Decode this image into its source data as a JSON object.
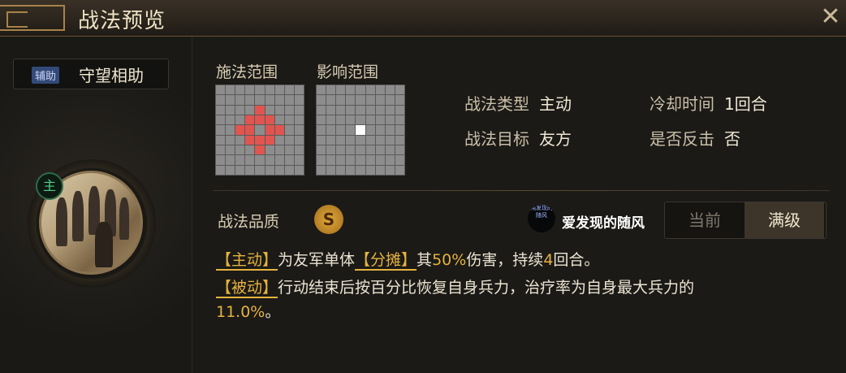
{
  "header": {
    "title": "战法预览",
    "close_icon": "close-icon"
  },
  "skill": {
    "type_badge": "辅助",
    "name": "守望相助",
    "commander_badge": "主"
  },
  "ranges": {
    "cast_label": "施法范围",
    "effect_label": "影响范围"
  },
  "info": {
    "type_label": "战法类型",
    "type_value": "主动",
    "cooldown_label": "冷却时间",
    "cooldown_value": "1回合",
    "target_label": "战法目标",
    "target_value": "友方",
    "counter_label": "是否反击",
    "counter_value": "否"
  },
  "quality": {
    "label": "战法品质",
    "grade": "S"
  },
  "watermark": {
    "icon_text": "纯发现的随风",
    "text": "爱发现的随风"
  },
  "level_toggle": {
    "current": "当前",
    "max": "满级"
  },
  "description": {
    "line1": {
      "tag1": "【主动】",
      "t1": "为友军单体",
      "tag2": "【分摊】",
      "t2": "其",
      "pct": "50%",
      "t3": "伤害，持续",
      "turns": "4",
      "t4": "回合。"
    },
    "line2": {
      "tag": "【被动】",
      "text": "行动结束后按百分比恢复自身兵力，治疗率为自身最大兵力的"
    },
    "line3": {
      "value": "11.0%",
      "end": "。"
    }
  },
  "colors": {
    "accent": "#e5b23e",
    "range_red": "#e05550",
    "grid_gray": "#8d8d8d"
  }
}
